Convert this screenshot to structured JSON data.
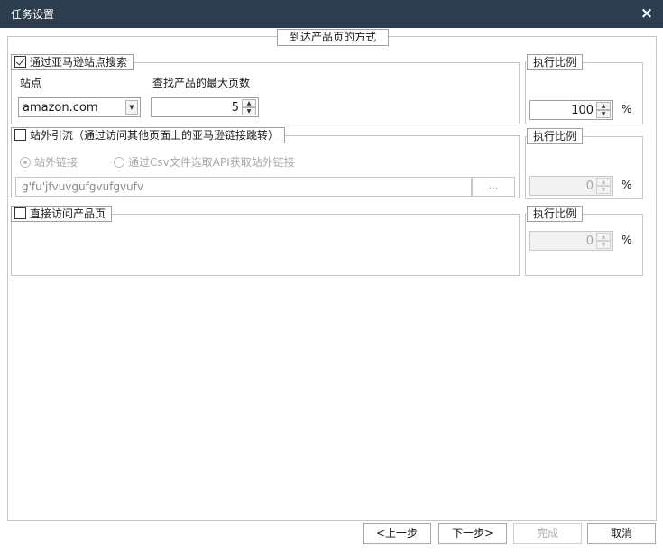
{
  "window": {
    "title": "任务设置",
    "close_glyph": "×"
  },
  "section_title": "到达产品页的方式",
  "amazon_search": {
    "checked": true,
    "label": "通过亚马逊站点搜索",
    "site_label": "站点",
    "site_value": "amazon.com",
    "max_pages_label": "查找产品的最大页数",
    "max_pages_value": "5"
  },
  "external_traffic": {
    "checked": false,
    "label": "站外引流（通过访问其他页面上的亚马逊链接跳转）",
    "radio_link_label": "站外链接",
    "radio_csv_label": "通过Csv文件选取API获取站外链接",
    "link_value": "g'fu'jfvuvgufgvufgvufv",
    "browse_label": "..."
  },
  "direct_visit": {
    "checked": false,
    "label": "直接访问产品页"
  },
  "ratio": [
    {
      "label": "执行比例",
      "value": "100",
      "unit": "%",
      "enabled": true
    },
    {
      "label": "执行比例",
      "value": "0",
      "unit": "%",
      "enabled": false
    },
    {
      "label": "执行比例",
      "value": "0",
      "unit": "%",
      "enabled": false
    }
  ],
  "footer": {
    "prev_label": "<上一步",
    "next_label": "下一步>",
    "finish_label": "完成",
    "cancel_label": "取消"
  },
  "colors": {
    "titlebar": "#2c3e50",
    "border": "#c6c6c6"
  }
}
